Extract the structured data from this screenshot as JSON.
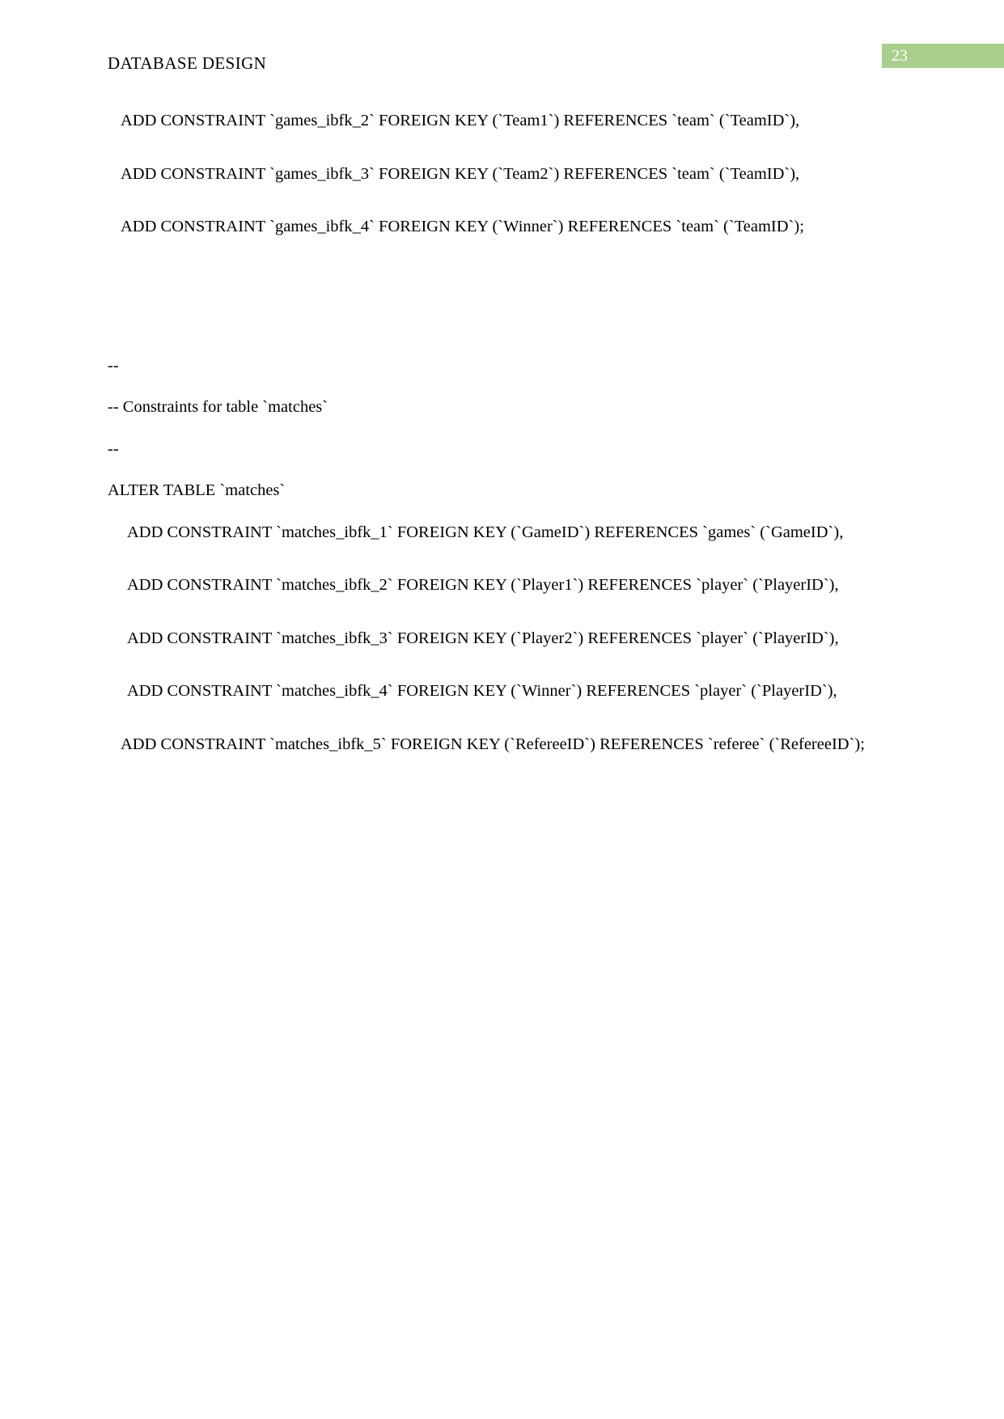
{
  "document": {
    "header_title": "DATABASE DESIGN",
    "page_number": "23",
    "badge_color": "#a9cf8f",
    "badge_text_color": "#ffffff",
    "text_color": "#000000",
    "background_color": "#ffffff"
  },
  "body": {
    "blocks": [
      {
        "id": "games_ibfk_2",
        "text": "ADD CONSTRAINT `games_ibfk_2` FOREIGN KEY (`Team1`) REFERENCES `team` (`TeamID`),"
      },
      {
        "id": "games_ibfk_3",
        "text": "ADD CONSTRAINT `games_ibfk_3` FOREIGN KEY (`Team2`) REFERENCES `team` (`TeamID`),"
      },
      {
        "id": "games_ibfk_4",
        "text": "ADD CONSTRAINT `games_ibfk_4` FOREIGN KEY (`Winner`) REFERENCES `team` (`TeamID`);"
      },
      {
        "id": "comment_open",
        "text": "--"
      },
      {
        "id": "comment_title",
        "text": "-- Constraints for table `matches`"
      },
      {
        "id": "comment_close",
        "text": "--"
      },
      {
        "id": "alter_table_matches",
        "text": "ALTER TABLE `matches`"
      },
      {
        "id": "matches_ibfk_1",
        "text": "ADD CONSTRAINT `matches_ibfk_1` FOREIGN KEY (`GameID`) REFERENCES `games` (`GameID`),"
      },
      {
        "id": "matches_ibfk_2",
        "text": "ADD CONSTRAINT `matches_ibfk_2` FOREIGN KEY (`Player1`) REFERENCES `player` (`PlayerID`),"
      },
      {
        "id": "matches_ibfk_3",
        "text": "ADD CONSTRAINT `matches_ibfk_3` FOREIGN KEY (`Player2`) REFERENCES `player` (`PlayerID`),"
      },
      {
        "id": "matches_ibfk_4",
        "text": "ADD CONSTRAINT `matches_ibfk_4` FOREIGN KEY (`Winner`) REFERENCES `player` (`PlayerID`),"
      },
      {
        "id": "matches_ibfk_5",
        "text": "ADD CONSTRAINT `matches_ibfk_5` FOREIGN KEY (`RefereeID`) REFERENCES `referee` (`RefereeID`);"
      }
    ]
  }
}
